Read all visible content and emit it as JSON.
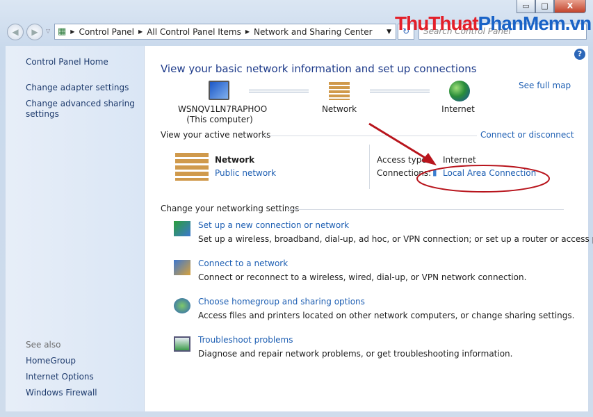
{
  "window": {
    "minimize": "▭",
    "maximize": "□",
    "close": "X"
  },
  "watermark": {
    "part1": "ThuThuat",
    "part2": "PhanMem.vn",
    "color1": "#e3202a",
    "color2": "#1a63c7"
  },
  "breadcrumb": [
    "Control Panel",
    "All Control Panel Items",
    "Network and Sharing Center"
  ],
  "search": {
    "placeholder": "Search Control Panel"
  },
  "sidebar": {
    "home": "Control Panel Home",
    "items": [
      "Change adapter settings",
      "Change advanced sharing settings"
    ],
    "see_also": "See also",
    "see_also_items": [
      "HomeGroup",
      "Internet Options",
      "Windows Firewall"
    ]
  },
  "main": {
    "title": "View your basic network information and set up connections",
    "see_full_map": "See full map",
    "map": {
      "computer": "WSNQV1LN7RAPHOO",
      "computer_sub": "(This computer)",
      "network": "Network",
      "internet": "Internet"
    },
    "active_header": "View your active networks",
    "connect_disconnect": "Connect or disconnect",
    "active": {
      "name": "Network",
      "type": "Public network",
      "access_label": "Access type:",
      "access_value": "Internet",
      "conn_label": "Connections:",
      "conn_value": "Local Area Connection"
    },
    "settings_header": "Change your networking settings",
    "tasks": [
      {
        "title": "Set up a new connection or network",
        "desc": "Set up a wireless, broadband, dial-up, ad hoc, or VPN connection; or set up a router or access point."
      },
      {
        "title": "Connect to a network",
        "desc": "Connect or reconnect to a wireless, wired, dial-up, or VPN network connection."
      },
      {
        "title": "Choose homegroup and sharing options",
        "desc": "Access files and printers located on other network computers, or change sharing settings."
      },
      {
        "title": "Troubleshoot problems",
        "desc": "Diagnose and repair network problems, or get troubleshooting information."
      }
    ]
  },
  "annotation_color": "#b8141c"
}
